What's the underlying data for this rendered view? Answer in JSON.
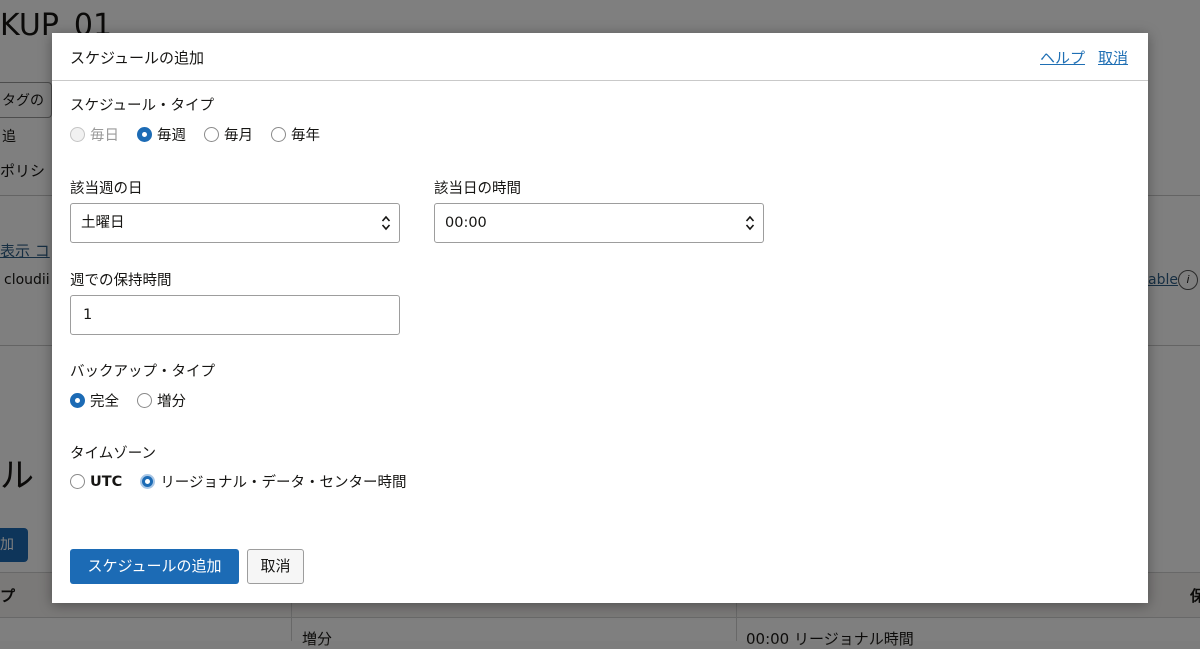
{
  "background": {
    "page_title": "KUP_01",
    "tag_button": "タグの追",
    "tab_label": "ポリシ",
    "links": "表示 コ",
    "cloud_text": "cloudii",
    "right_link": "able",
    "info_glyph": "i",
    "section_title": "ル",
    "add_button": "加",
    "table_header_left": "プ",
    "table_header_right": "保",
    "row_backup_type": "増分",
    "row_time": "00:00 リージョナル時間"
  },
  "dialog": {
    "title": "スケジュールの追加",
    "help_link": "ヘルプ",
    "cancel_link": "取消",
    "schedule_type": {
      "label": "スケジュール・タイプ",
      "options": [
        "毎日",
        "毎週",
        "毎月",
        "毎年"
      ],
      "selected": "毎週",
      "disabled": [
        "毎日"
      ]
    },
    "day_of_week": {
      "label": "該当週の日",
      "value": "土曜日"
    },
    "time_of_day": {
      "label": "該当日の時間",
      "value": "00:00"
    },
    "retention": {
      "label": "週での保持時間",
      "value": "1"
    },
    "backup_type": {
      "label": "バックアップ・タイプ",
      "options": [
        "完全",
        "増分"
      ],
      "selected": "完全"
    },
    "timezone": {
      "label": "タイムゾーン",
      "options": [
        "UTC",
        "リージョナル・データ・センター時間"
      ],
      "selected": "リージョナル・データ・センター時間"
    },
    "submit_button": "スケジュールの追加",
    "cancel_button": "取消"
  },
  "colors": {
    "accent": "#1c6bb5",
    "link": "#1f6fb4",
    "overlay": "rgba(0,0,0,0.5)"
  }
}
